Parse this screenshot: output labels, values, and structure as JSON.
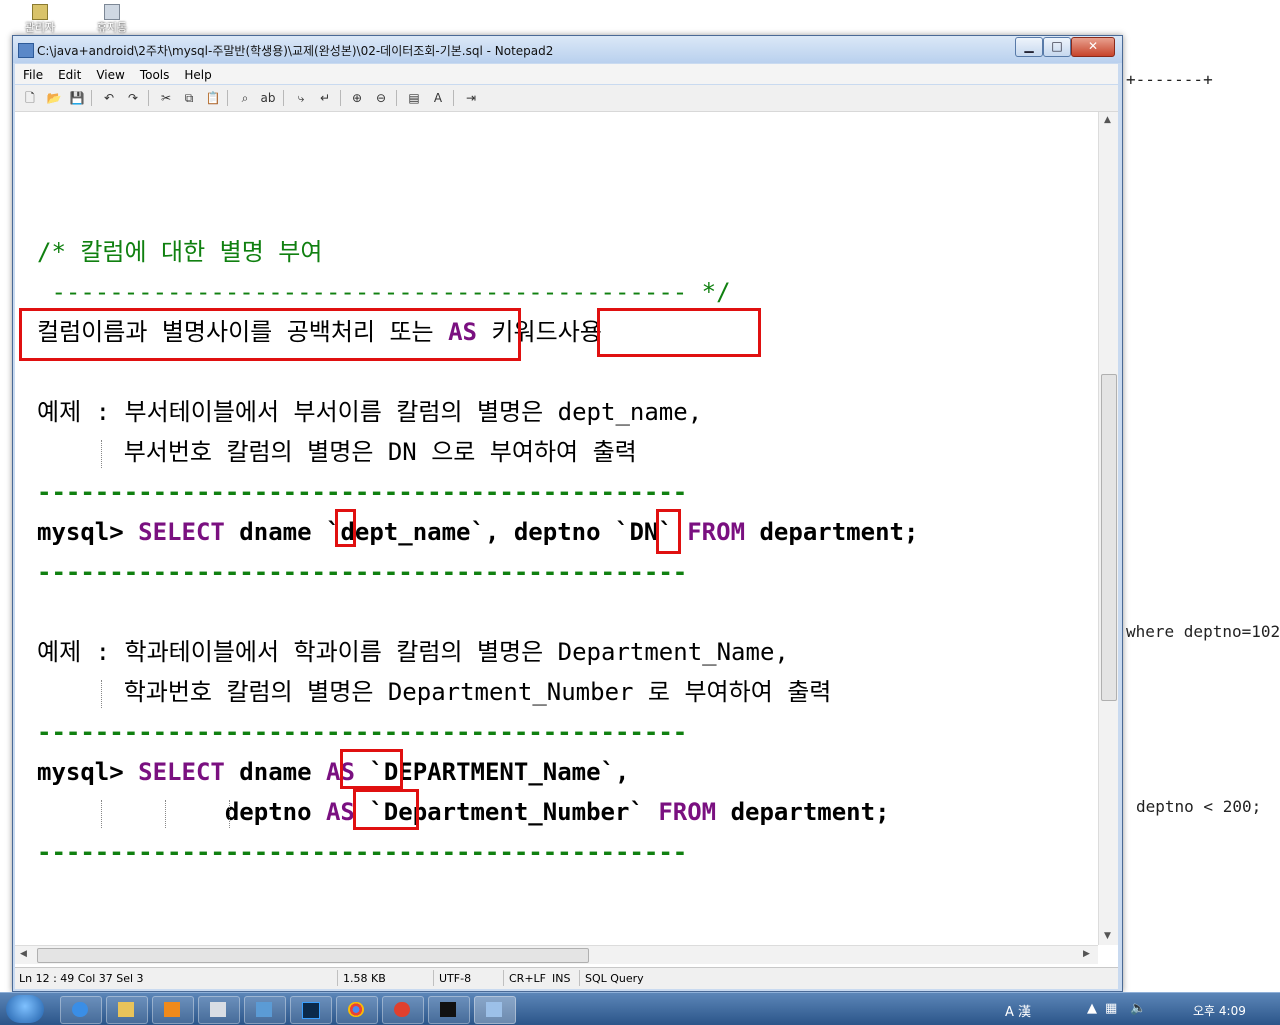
{
  "desktop": {
    "icons": [
      {
        "label": "관리자"
      },
      {
        "label": "휴지통"
      }
    ],
    "background_text": [
      "+-------+",
      "where deptno=102",
      "deptno < 200;"
    ]
  },
  "window": {
    "title": "C:\\java+android\\2주차\\mysql-주말반(학생용)\\교제(완성본)\\02-데이터조회-기본.sql - Notepad2",
    "buttons": {
      "minimize": "▁",
      "maximize": "□",
      "close": "✕"
    }
  },
  "menu": [
    "File",
    "Edit",
    "View",
    "Tools",
    "Help"
  ],
  "toolbar_icons": [
    "new-icon",
    "open-icon",
    "save-icon",
    "undo-icon",
    "redo-icon",
    "cut-icon",
    "copy-icon",
    "paste-icon",
    "find-icon",
    "replace-icon",
    "goto-icon",
    "wordwrap-icon",
    "zoom-in-icon",
    "zoom-out-icon",
    "schemes-icon",
    "font-icon",
    "exit-icon"
  ],
  "editor": {
    "comment_line1": "/* 칼럼에 대한 별명 부여",
    "comment_line2": " -------------------------------------------- */",
    "rule_prefix": "컬럼이름과 별명사이를 공백처리 ",
    "rule_or": "또는 ",
    "rule_as": "AS",
    "rule_keyword": " 키워드",
    "rule_suffix": "사용",
    "ex1_line1": "예제 : 부서테이블에서 부서이름 칼럼의 별명은 dept_name,",
    "ex1_line2": "      부서번호 칼럼의 별명은 DN 으로 부여하여 출력",
    "dashes": "---------------------------------------------",
    "sql1_prompt": "mysql> ",
    "sql1_select": "SELECT",
    "sql1_part1": " dname `dept_name`, deptno `DN` ",
    "sql1_from": "FROM",
    "sql1_part2": " department;",
    "ex2_line1": "예제 : 학과테이블에서 학과이름 칼럼의 별명은 Department_Name,",
    "ex2_line2": "      학과번호 칼럼의 별명은 Department_Number 로 부여하여 출력",
    "sql2_prompt": "mysql> ",
    "sql2_select": "SELECT",
    "sql2_part1": " dname ",
    "sql2_as1": "AS",
    "sql2_part2": " `DEPARTMENT_Name`,",
    "sql2_indent": "             deptno ",
    "sql2_as2": "AS",
    "sql2_part3": " `Department_Number` ",
    "sql2_from": "FROM",
    "sql2_part4": " department;"
  },
  "statusbar": {
    "position": "Ln 12 : 49   Col 37   Sel 3",
    "size": "1.58 KB",
    "encoding": "UTF-8",
    "eol": "CR+LF",
    "ins": "INS",
    "lexer": "SQL Query"
  },
  "taskbar": {
    "tray_text": "A 漢",
    "clock": "오후 4:09"
  },
  "colors": {
    "keyword": "#7a1080",
    "comment": "#108010",
    "highlight_box": "#e01010"
  }
}
